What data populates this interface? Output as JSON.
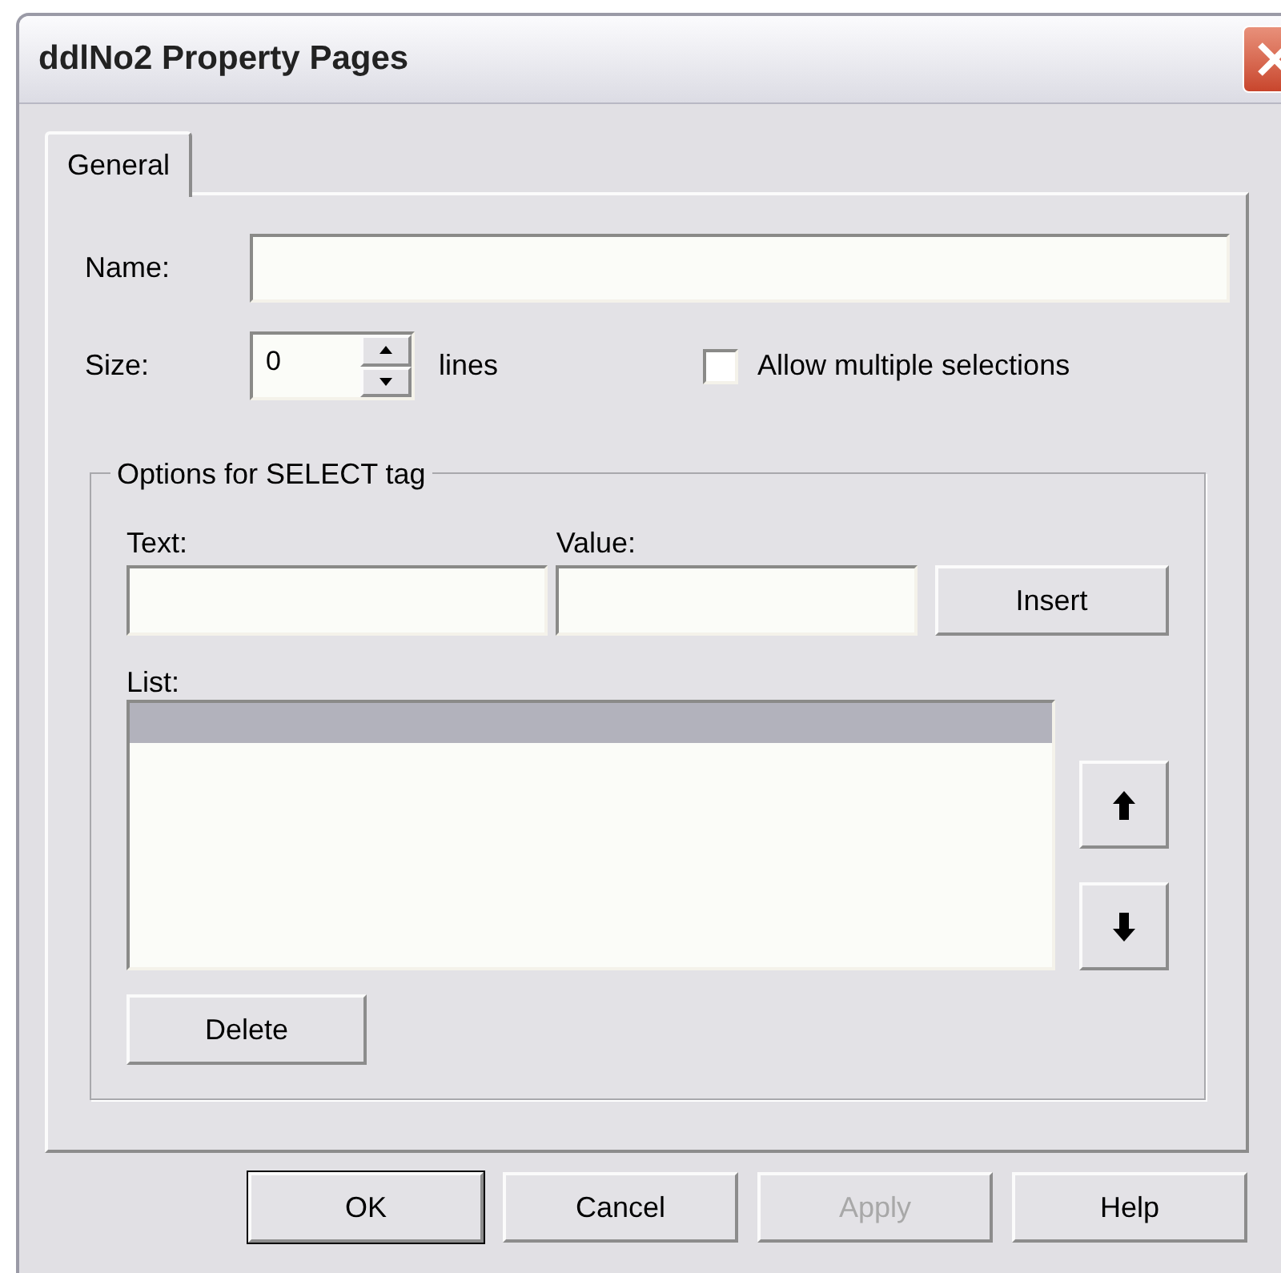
{
  "window": {
    "title": "ddlNo2 Property Pages"
  },
  "tabs": [
    {
      "label": "General",
      "selected": true
    }
  ],
  "name_field": {
    "label": "Name:"
  },
  "size_field": {
    "label": "Size:",
    "value": "0",
    "unit": "lines"
  },
  "allow_multiple": {
    "label": "Allow multiple selections",
    "checked": false
  },
  "options_group": {
    "legend": "Options for SELECT tag",
    "text_field": {
      "label": "Text:"
    },
    "value_field": {
      "label": "Value:"
    },
    "insert_button": {
      "label": "Insert"
    },
    "list": {
      "label": "List:",
      "rows": [
        {
          "selected": true
        }
      ]
    },
    "delete_button": {
      "label": "Delete"
    }
  },
  "buttons": [
    {
      "label": "OK",
      "default": true,
      "disabled": false
    },
    {
      "label": "Cancel",
      "default": false,
      "disabled": false
    },
    {
      "label": "Apply",
      "default": false,
      "disabled": true
    },
    {
      "label": "Help",
      "default": false,
      "disabled": false
    }
  ]
}
